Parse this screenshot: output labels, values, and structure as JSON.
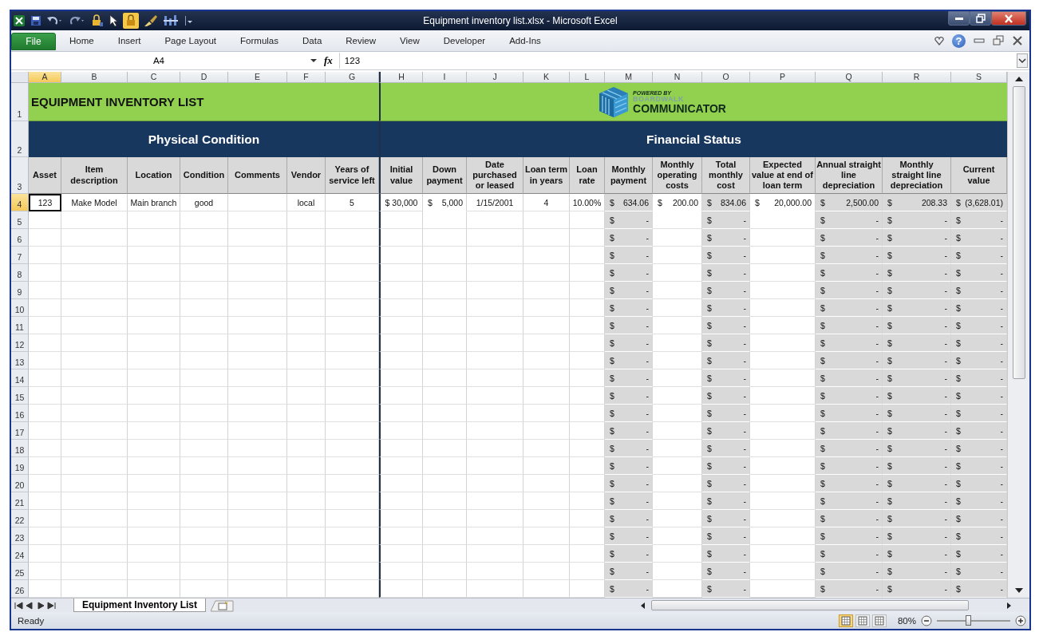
{
  "window": {
    "title": "Equipment inventory list.xlsx  -  Microsoft Excel"
  },
  "ribbon_tabs": [
    {
      "label": "File",
      "kind": "file"
    },
    {
      "label": "Home",
      "kind": "tab"
    },
    {
      "label": "Insert",
      "kind": "tab"
    },
    {
      "label": "Page Layout",
      "kind": "tab"
    },
    {
      "label": "Formulas",
      "kind": "tab"
    },
    {
      "label": "Data",
      "kind": "tab"
    },
    {
      "label": "Review",
      "kind": "tab"
    },
    {
      "label": "View",
      "kind": "tab"
    },
    {
      "label": "Developer",
      "kind": "tab"
    },
    {
      "label": "Add-Ins",
      "kind": "tab"
    }
  ],
  "help_label": "?",
  "formula_bar": {
    "name_box": "A4",
    "fx": "fx",
    "value": "123"
  },
  "columns": [
    {
      "letter": "A",
      "selected": true
    },
    {
      "letter": "B",
      "selected": false
    },
    {
      "letter": "C",
      "selected": false
    },
    {
      "letter": "D",
      "selected": false
    },
    {
      "letter": "E",
      "selected": false
    },
    {
      "letter": "F",
      "selected": false
    },
    {
      "letter": "G",
      "selected": false
    },
    {
      "letter": "H",
      "selected": false
    },
    {
      "letter": "I",
      "selected": false
    },
    {
      "letter": "J",
      "selected": false
    },
    {
      "letter": "K",
      "selected": false
    },
    {
      "letter": "L",
      "selected": false
    },
    {
      "letter": "M",
      "selected": false
    },
    {
      "letter": "N",
      "selected": false
    },
    {
      "letter": "O",
      "selected": false
    },
    {
      "letter": "P",
      "selected": false
    },
    {
      "letter": "Q",
      "selected": false
    },
    {
      "letter": "R",
      "selected": false
    },
    {
      "letter": "S",
      "selected": false
    }
  ],
  "row_headers": [
    {
      "label": "1",
      "selected": false
    },
    {
      "label": "2",
      "selected": false
    },
    {
      "label": "3",
      "selected": false
    },
    {
      "label": "4",
      "selected": true
    },
    {
      "label": "5",
      "selected": false
    },
    {
      "label": "6",
      "selected": false
    },
    {
      "label": "7",
      "selected": false
    },
    {
      "label": "8",
      "selected": false
    },
    {
      "label": "9",
      "selected": false
    },
    {
      "label": "10",
      "selected": false
    },
    {
      "label": "11",
      "selected": false
    },
    {
      "label": "12",
      "selected": false
    },
    {
      "label": "13",
      "selected": false
    },
    {
      "label": "14",
      "selected": false
    },
    {
      "label": "15",
      "selected": false
    },
    {
      "label": "16",
      "selected": false
    },
    {
      "label": "17",
      "selected": false
    },
    {
      "label": "18",
      "selected": false
    },
    {
      "label": "19",
      "selected": false
    },
    {
      "label": "20",
      "selected": false
    },
    {
      "label": "21",
      "selected": false
    },
    {
      "label": "22",
      "selected": false
    },
    {
      "label": "23",
      "selected": false
    },
    {
      "label": "24",
      "selected": false
    },
    {
      "label": "25",
      "selected": false
    },
    {
      "label": "26",
      "selected": false
    }
  ],
  "sheet": {
    "title": "EQUIPMENT INVENTORY LIST",
    "logo": {
      "tagline": "POWERED BY",
      "brand": "BOARDWALK",
      "product": "COMMUNICATOR"
    },
    "sections": [
      {
        "label": "Physical Condition"
      },
      {
        "label": "Financial Status"
      }
    ],
    "headings": [
      "Asset",
      "Item description",
      "Location",
      "Condition",
      "Comments",
      "Vendor",
      "Years of service left",
      "Initial value",
      "Down payment",
      "Date purchased or leased",
      "Loan term in years",
      "Loan rate",
      "Monthly payment",
      "Monthly operating costs",
      "Total monthly cost",
      "Expected value at end of loan term",
      "Annual straight line depreciation",
      "Monthly straight line depreciation",
      "Current value"
    ],
    "rows": [
      {
        "cells": [
          {
            "kind": "text",
            "text": "123",
            "selected": true
          },
          {
            "kind": "text",
            "text": "Make Model",
            "selected": false
          },
          {
            "kind": "text",
            "text": "Main branch",
            "selected": false
          },
          {
            "kind": "text",
            "text": "good",
            "selected": false
          },
          {
            "kind": "empty"
          },
          {
            "kind": "text",
            "text": "local",
            "selected": false
          },
          {
            "kind": "text",
            "text": "5",
            "selected": false
          },
          {
            "kind": "text",
            "text": "$ 30,000",
            "selected": false
          },
          {
            "kind": "money",
            "symbol": "$",
            "amount": "5,000",
            "shaded": false
          },
          {
            "kind": "text",
            "text": "1/15/2001",
            "selected": false
          },
          {
            "kind": "text",
            "text": "4",
            "selected": false
          },
          {
            "kind": "text",
            "text": "10.00%",
            "selected": false
          },
          {
            "kind": "money",
            "symbol": "$",
            "amount": "634.06",
            "shaded": true
          },
          {
            "kind": "money",
            "symbol": "$",
            "amount": "200.00",
            "shaded": false
          },
          {
            "kind": "money",
            "symbol": "$",
            "amount": "834.06",
            "shaded": true
          },
          {
            "kind": "money",
            "symbol": "$",
            "amount": "20,000.00",
            "shaded": false
          },
          {
            "kind": "money",
            "symbol": "$",
            "amount": "2,500.00",
            "shaded": true
          },
          {
            "kind": "money",
            "symbol": "$",
            "amount": "208.33",
            "shaded": true
          },
          {
            "kind": "money",
            "symbol": "$",
            "amount": "(3,628.01)",
            "shaded": true
          }
        ]
      },
      {
        "cells": [
          {
            "kind": "empty"
          },
          {
            "kind": "empty"
          },
          {
            "kind": "empty"
          },
          {
            "kind": "empty"
          },
          {
            "kind": "empty"
          },
          {
            "kind": "empty"
          },
          {
            "kind": "empty"
          },
          {
            "kind": "empty"
          },
          {
            "kind": "empty"
          },
          {
            "kind": "empty"
          },
          {
            "kind": "empty"
          },
          {
            "kind": "empty"
          },
          {
            "kind": "money",
            "symbol": "$",
            "amount": "-",
            "shaded": true
          },
          {
            "kind": "empty"
          },
          {
            "kind": "money",
            "symbol": "$",
            "amount": "-",
            "shaded": true
          },
          {
            "kind": "empty"
          },
          {
            "kind": "money",
            "symbol": "$",
            "amount": "-",
            "shaded": true
          },
          {
            "kind": "money",
            "symbol": "$",
            "amount": "-",
            "shaded": true
          },
          {
            "kind": "money",
            "symbol": "$",
            "amount": "-",
            "shaded": true
          }
        ]
      },
      {
        "cells": [
          {
            "kind": "empty"
          },
          {
            "kind": "empty"
          },
          {
            "kind": "empty"
          },
          {
            "kind": "empty"
          },
          {
            "kind": "empty"
          },
          {
            "kind": "empty"
          },
          {
            "kind": "empty"
          },
          {
            "kind": "empty"
          },
          {
            "kind": "empty"
          },
          {
            "kind": "empty"
          },
          {
            "kind": "empty"
          },
          {
            "kind": "empty"
          },
          {
            "kind": "money",
            "symbol": "$",
            "amount": "-",
            "shaded": true
          },
          {
            "kind": "empty"
          },
          {
            "kind": "money",
            "symbol": "$",
            "amount": "-",
            "shaded": true
          },
          {
            "kind": "empty"
          },
          {
            "kind": "money",
            "symbol": "$",
            "amount": "-",
            "shaded": true
          },
          {
            "kind": "money",
            "symbol": "$",
            "amount": "-",
            "shaded": true
          },
          {
            "kind": "money",
            "symbol": "$",
            "amount": "-",
            "shaded": true
          }
        ]
      },
      {
        "cells": [
          {
            "kind": "empty"
          },
          {
            "kind": "empty"
          },
          {
            "kind": "empty"
          },
          {
            "kind": "empty"
          },
          {
            "kind": "empty"
          },
          {
            "kind": "empty"
          },
          {
            "kind": "empty"
          },
          {
            "kind": "empty"
          },
          {
            "kind": "empty"
          },
          {
            "kind": "empty"
          },
          {
            "kind": "empty"
          },
          {
            "kind": "empty"
          },
          {
            "kind": "money",
            "symbol": "$",
            "amount": "-",
            "shaded": true
          },
          {
            "kind": "empty"
          },
          {
            "kind": "money",
            "symbol": "$",
            "amount": "-",
            "shaded": true
          },
          {
            "kind": "empty"
          },
          {
            "kind": "money",
            "symbol": "$",
            "amount": "-",
            "shaded": true
          },
          {
            "kind": "money",
            "symbol": "$",
            "amount": "-",
            "shaded": true
          },
          {
            "kind": "money",
            "symbol": "$",
            "amount": "-",
            "shaded": true
          }
        ]
      },
      {
        "cells": [
          {
            "kind": "empty"
          },
          {
            "kind": "empty"
          },
          {
            "kind": "empty"
          },
          {
            "kind": "empty"
          },
          {
            "kind": "empty"
          },
          {
            "kind": "empty"
          },
          {
            "kind": "empty"
          },
          {
            "kind": "empty"
          },
          {
            "kind": "empty"
          },
          {
            "kind": "empty"
          },
          {
            "kind": "empty"
          },
          {
            "kind": "empty"
          },
          {
            "kind": "money",
            "symbol": "$",
            "amount": "-",
            "shaded": true
          },
          {
            "kind": "empty"
          },
          {
            "kind": "money",
            "symbol": "$",
            "amount": "-",
            "shaded": true
          },
          {
            "kind": "empty"
          },
          {
            "kind": "money",
            "symbol": "$",
            "amount": "-",
            "shaded": true
          },
          {
            "kind": "money",
            "symbol": "$",
            "amount": "-",
            "shaded": true
          },
          {
            "kind": "money",
            "symbol": "$",
            "amount": "-",
            "shaded": true
          }
        ]
      },
      {
        "cells": [
          {
            "kind": "empty"
          },
          {
            "kind": "empty"
          },
          {
            "kind": "empty"
          },
          {
            "kind": "empty"
          },
          {
            "kind": "empty"
          },
          {
            "kind": "empty"
          },
          {
            "kind": "empty"
          },
          {
            "kind": "empty"
          },
          {
            "kind": "empty"
          },
          {
            "kind": "empty"
          },
          {
            "kind": "empty"
          },
          {
            "kind": "empty"
          },
          {
            "kind": "money",
            "symbol": "$",
            "amount": "-",
            "shaded": true
          },
          {
            "kind": "empty"
          },
          {
            "kind": "money",
            "symbol": "$",
            "amount": "-",
            "shaded": true
          },
          {
            "kind": "empty"
          },
          {
            "kind": "money",
            "symbol": "$",
            "amount": "-",
            "shaded": true
          },
          {
            "kind": "money",
            "symbol": "$",
            "amount": "-",
            "shaded": true
          },
          {
            "kind": "money",
            "symbol": "$",
            "amount": "-",
            "shaded": true
          }
        ]
      },
      {
        "cells": [
          {
            "kind": "empty"
          },
          {
            "kind": "empty"
          },
          {
            "kind": "empty"
          },
          {
            "kind": "empty"
          },
          {
            "kind": "empty"
          },
          {
            "kind": "empty"
          },
          {
            "kind": "empty"
          },
          {
            "kind": "empty"
          },
          {
            "kind": "empty"
          },
          {
            "kind": "empty"
          },
          {
            "kind": "empty"
          },
          {
            "kind": "empty"
          },
          {
            "kind": "money",
            "symbol": "$",
            "amount": "-",
            "shaded": true
          },
          {
            "kind": "empty"
          },
          {
            "kind": "money",
            "symbol": "$",
            "amount": "-",
            "shaded": true
          },
          {
            "kind": "empty"
          },
          {
            "kind": "money",
            "symbol": "$",
            "amount": "-",
            "shaded": true
          },
          {
            "kind": "money",
            "symbol": "$",
            "amount": "-",
            "shaded": true
          },
          {
            "kind": "money",
            "symbol": "$",
            "amount": "-",
            "shaded": true
          }
        ]
      },
      {
        "cells": [
          {
            "kind": "empty"
          },
          {
            "kind": "empty"
          },
          {
            "kind": "empty"
          },
          {
            "kind": "empty"
          },
          {
            "kind": "empty"
          },
          {
            "kind": "empty"
          },
          {
            "kind": "empty"
          },
          {
            "kind": "empty"
          },
          {
            "kind": "empty"
          },
          {
            "kind": "empty"
          },
          {
            "kind": "empty"
          },
          {
            "kind": "empty"
          },
          {
            "kind": "money",
            "symbol": "$",
            "amount": "-",
            "shaded": true
          },
          {
            "kind": "empty"
          },
          {
            "kind": "money",
            "symbol": "$",
            "amount": "-",
            "shaded": true
          },
          {
            "kind": "empty"
          },
          {
            "kind": "money",
            "symbol": "$",
            "amount": "-",
            "shaded": true
          },
          {
            "kind": "money",
            "symbol": "$",
            "amount": "-",
            "shaded": true
          },
          {
            "kind": "money",
            "symbol": "$",
            "amount": "-",
            "shaded": true
          }
        ]
      },
      {
        "cells": [
          {
            "kind": "empty"
          },
          {
            "kind": "empty"
          },
          {
            "kind": "empty"
          },
          {
            "kind": "empty"
          },
          {
            "kind": "empty"
          },
          {
            "kind": "empty"
          },
          {
            "kind": "empty"
          },
          {
            "kind": "empty"
          },
          {
            "kind": "empty"
          },
          {
            "kind": "empty"
          },
          {
            "kind": "empty"
          },
          {
            "kind": "empty"
          },
          {
            "kind": "money",
            "symbol": "$",
            "amount": "-",
            "shaded": true
          },
          {
            "kind": "empty"
          },
          {
            "kind": "money",
            "symbol": "$",
            "amount": "-",
            "shaded": true
          },
          {
            "kind": "empty"
          },
          {
            "kind": "money",
            "symbol": "$",
            "amount": "-",
            "shaded": true
          },
          {
            "kind": "money",
            "symbol": "$",
            "amount": "-",
            "shaded": true
          },
          {
            "kind": "money",
            "symbol": "$",
            "amount": "-",
            "shaded": true
          }
        ]
      },
      {
        "cells": [
          {
            "kind": "empty"
          },
          {
            "kind": "empty"
          },
          {
            "kind": "empty"
          },
          {
            "kind": "empty"
          },
          {
            "kind": "empty"
          },
          {
            "kind": "empty"
          },
          {
            "kind": "empty"
          },
          {
            "kind": "empty"
          },
          {
            "kind": "empty"
          },
          {
            "kind": "empty"
          },
          {
            "kind": "empty"
          },
          {
            "kind": "empty"
          },
          {
            "kind": "money",
            "symbol": "$",
            "amount": "-",
            "shaded": true
          },
          {
            "kind": "empty"
          },
          {
            "kind": "money",
            "symbol": "$",
            "amount": "-",
            "shaded": true
          },
          {
            "kind": "empty"
          },
          {
            "kind": "money",
            "symbol": "$",
            "amount": "-",
            "shaded": true
          },
          {
            "kind": "money",
            "symbol": "$",
            "amount": "-",
            "shaded": true
          },
          {
            "kind": "money",
            "symbol": "$",
            "amount": "-",
            "shaded": true
          }
        ]
      },
      {
        "cells": [
          {
            "kind": "empty"
          },
          {
            "kind": "empty"
          },
          {
            "kind": "empty"
          },
          {
            "kind": "empty"
          },
          {
            "kind": "empty"
          },
          {
            "kind": "empty"
          },
          {
            "kind": "empty"
          },
          {
            "kind": "empty"
          },
          {
            "kind": "empty"
          },
          {
            "kind": "empty"
          },
          {
            "kind": "empty"
          },
          {
            "kind": "empty"
          },
          {
            "kind": "money",
            "symbol": "$",
            "amount": "-",
            "shaded": true
          },
          {
            "kind": "empty"
          },
          {
            "kind": "money",
            "symbol": "$",
            "amount": "-",
            "shaded": true
          },
          {
            "kind": "empty"
          },
          {
            "kind": "money",
            "symbol": "$",
            "amount": "-",
            "shaded": true
          },
          {
            "kind": "money",
            "symbol": "$",
            "amount": "-",
            "shaded": true
          },
          {
            "kind": "money",
            "symbol": "$",
            "amount": "-",
            "shaded": true
          }
        ]
      },
      {
        "cells": [
          {
            "kind": "empty"
          },
          {
            "kind": "empty"
          },
          {
            "kind": "empty"
          },
          {
            "kind": "empty"
          },
          {
            "kind": "empty"
          },
          {
            "kind": "empty"
          },
          {
            "kind": "empty"
          },
          {
            "kind": "empty"
          },
          {
            "kind": "empty"
          },
          {
            "kind": "empty"
          },
          {
            "kind": "empty"
          },
          {
            "kind": "empty"
          },
          {
            "kind": "money",
            "symbol": "$",
            "amount": "-",
            "shaded": true
          },
          {
            "kind": "empty"
          },
          {
            "kind": "money",
            "symbol": "$",
            "amount": "-",
            "shaded": true
          },
          {
            "kind": "empty"
          },
          {
            "kind": "money",
            "symbol": "$",
            "amount": "-",
            "shaded": true
          },
          {
            "kind": "money",
            "symbol": "$",
            "amount": "-",
            "shaded": true
          },
          {
            "kind": "money",
            "symbol": "$",
            "amount": "-",
            "shaded": true
          }
        ]
      },
      {
        "cells": [
          {
            "kind": "empty"
          },
          {
            "kind": "empty"
          },
          {
            "kind": "empty"
          },
          {
            "kind": "empty"
          },
          {
            "kind": "empty"
          },
          {
            "kind": "empty"
          },
          {
            "kind": "empty"
          },
          {
            "kind": "empty"
          },
          {
            "kind": "empty"
          },
          {
            "kind": "empty"
          },
          {
            "kind": "empty"
          },
          {
            "kind": "empty"
          },
          {
            "kind": "money",
            "symbol": "$",
            "amount": "-",
            "shaded": true
          },
          {
            "kind": "empty"
          },
          {
            "kind": "money",
            "symbol": "$",
            "amount": "-",
            "shaded": true
          },
          {
            "kind": "empty"
          },
          {
            "kind": "money",
            "symbol": "$",
            "amount": "-",
            "shaded": true
          },
          {
            "kind": "money",
            "symbol": "$",
            "amount": "-",
            "shaded": true
          },
          {
            "kind": "money",
            "symbol": "$",
            "amount": "-",
            "shaded": true
          }
        ]
      },
      {
        "cells": [
          {
            "kind": "empty"
          },
          {
            "kind": "empty"
          },
          {
            "kind": "empty"
          },
          {
            "kind": "empty"
          },
          {
            "kind": "empty"
          },
          {
            "kind": "empty"
          },
          {
            "kind": "empty"
          },
          {
            "kind": "empty"
          },
          {
            "kind": "empty"
          },
          {
            "kind": "empty"
          },
          {
            "kind": "empty"
          },
          {
            "kind": "empty"
          },
          {
            "kind": "money",
            "symbol": "$",
            "amount": "-",
            "shaded": true
          },
          {
            "kind": "empty"
          },
          {
            "kind": "money",
            "symbol": "$",
            "amount": "-",
            "shaded": true
          },
          {
            "kind": "empty"
          },
          {
            "kind": "money",
            "symbol": "$",
            "amount": "-",
            "shaded": true
          },
          {
            "kind": "money",
            "symbol": "$",
            "amount": "-",
            "shaded": true
          },
          {
            "kind": "money",
            "symbol": "$",
            "amount": "-",
            "shaded": true
          }
        ]
      },
      {
        "cells": [
          {
            "kind": "empty"
          },
          {
            "kind": "empty"
          },
          {
            "kind": "empty"
          },
          {
            "kind": "empty"
          },
          {
            "kind": "empty"
          },
          {
            "kind": "empty"
          },
          {
            "kind": "empty"
          },
          {
            "kind": "empty"
          },
          {
            "kind": "empty"
          },
          {
            "kind": "empty"
          },
          {
            "kind": "empty"
          },
          {
            "kind": "empty"
          },
          {
            "kind": "money",
            "symbol": "$",
            "amount": "-",
            "shaded": true
          },
          {
            "kind": "empty"
          },
          {
            "kind": "money",
            "symbol": "$",
            "amount": "-",
            "shaded": true
          },
          {
            "kind": "empty"
          },
          {
            "kind": "money",
            "symbol": "$",
            "amount": "-",
            "shaded": true
          },
          {
            "kind": "money",
            "symbol": "$",
            "amount": "-",
            "shaded": true
          },
          {
            "kind": "money",
            "symbol": "$",
            "amount": "-",
            "shaded": true
          }
        ]
      },
      {
        "cells": [
          {
            "kind": "empty"
          },
          {
            "kind": "empty"
          },
          {
            "kind": "empty"
          },
          {
            "kind": "empty"
          },
          {
            "kind": "empty"
          },
          {
            "kind": "empty"
          },
          {
            "kind": "empty"
          },
          {
            "kind": "empty"
          },
          {
            "kind": "empty"
          },
          {
            "kind": "empty"
          },
          {
            "kind": "empty"
          },
          {
            "kind": "empty"
          },
          {
            "kind": "money",
            "symbol": "$",
            "amount": "-",
            "shaded": true
          },
          {
            "kind": "empty"
          },
          {
            "kind": "money",
            "symbol": "$",
            "amount": "-",
            "shaded": true
          },
          {
            "kind": "empty"
          },
          {
            "kind": "money",
            "symbol": "$",
            "amount": "-",
            "shaded": true
          },
          {
            "kind": "money",
            "symbol": "$",
            "amount": "-",
            "shaded": true
          },
          {
            "kind": "money",
            "symbol": "$",
            "amount": "-",
            "shaded": true
          }
        ]
      },
      {
        "cells": [
          {
            "kind": "empty"
          },
          {
            "kind": "empty"
          },
          {
            "kind": "empty"
          },
          {
            "kind": "empty"
          },
          {
            "kind": "empty"
          },
          {
            "kind": "empty"
          },
          {
            "kind": "empty"
          },
          {
            "kind": "empty"
          },
          {
            "kind": "empty"
          },
          {
            "kind": "empty"
          },
          {
            "kind": "empty"
          },
          {
            "kind": "empty"
          },
          {
            "kind": "money",
            "symbol": "$",
            "amount": "-",
            "shaded": true
          },
          {
            "kind": "empty"
          },
          {
            "kind": "money",
            "symbol": "$",
            "amount": "-",
            "shaded": true
          },
          {
            "kind": "empty"
          },
          {
            "kind": "money",
            "symbol": "$",
            "amount": "-",
            "shaded": true
          },
          {
            "kind": "money",
            "symbol": "$",
            "amount": "-",
            "shaded": true
          },
          {
            "kind": "money",
            "symbol": "$",
            "amount": "-",
            "shaded": true
          }
        ]
      },
      {
        "cells": [
          {
            "kind": "empty"
          },
          {
            "kind": "empty"
          },
          {
            "kind": "empty"
          },
          {
            "kind": "empty"
          },
          {
            "kind": "empty"
          },
          {
            "kind": "empty"
          },
          {
            "kind": "empty"
          },
          {
            "kind": "empty"
          },
          {
            "kind": "empty"
          },
          {
            "kind": "empty"
          },
          {
            "kind": "empty"
          },
          {
            "kind": "empty"
          },
          {
            "kind": "money",
            "symbol": "$",
            "amount": "-",
            "shaded": true
          },
          {
            "kind": "empty"
          },
          {
            "kind": "money",
            "symbol": "$",
            "amount": "-",
            "shaded": true
          },
          {
            "kind": "empty"
          },
          {
            "kind": "money",
            "symbol": "$",
            "amount": "-",
            "shaded": true
          },
          {
            "kind": "money",
            "symbol": "$",
            "amount": "-",
            "shaded": true
          },
          {
            "kind": "money",
            "symbol": "$",
            "amount": "-",
            "shaded": true
          }
        ]
      },
      {
        "cells": [
          {
            "kind": "empty"
          },
          {
            "kind": "empty"
          },
          {
            "kind": "empty"
          },
          {
            "kind": "empty"
          },
          {
            "kind": "empty"
          },
          {
            "kind": "empty"
          },
          {
            "kind": "empty"
          },
          {
            "kind": "empty"
          },
          {
            "kind": "empty"
          },
          {
            "kind": "empty"
          },
          {
            "kind": "empty"
          },
          {
            "kind": "empty"
          },
          {
            "kind": "money",
            "symbol": "$",
            "amount": "-",
            "shaded": true
          },
          {
            "kind": "empty"
          },
          {
            "kind": "money",
            "symbol": "$",
            "amount": "-",
            "shaded": true
          },
          {
            "kind": "empty"
          },
          {
            "kind": "money",
            "symbol": "$",
            "amount": "-",
            "shaded": true
          },
          {
            "kind": "money",
            "symbol": "$",
            "amount": "-",
            "shaded": true
          },
          {
            "kind": "money",
            "symbol": "$",
            "amount": "-",
            "shaded": true
          }
        ]
      },
      {
        "cells": [
          {
            "kind": "empty"
          },
          {
            "kind": "empty"
          },
          {
            "kind": "empty"
          },
          {
            "kind": "empty"
          },
          {
            "kind": "empty"
          },
          {
            "kind": "empty"
          },
          {
            "kind": "empty"
          },
          {
            "kind": "empty"
          },
          {
            "kind": "empty"
          },
          {
            "kind": "empty"
          },
          {
            "kind": "empty"
          },
          {
            "kind": "empty"
          },
          {
            "kind": "money",
            "symbol": "$",
            "amount": "-",
            "shaded": true
          },
          {
            "kind": "empty"
          },
          {
            "kind": "money",
            "symbol": "$",
            "amount": "-",
            "shaded": true
          },
          {
            "kind": "empty"
          },
          {
            "kind": "money",
            "symbol": "$",
            "amount": "-",
            "shaded": true
          },
          {
            "kind": "money",
            "symbol": "$",
            "amount": "-",
            "shaded": true
          },
          {
            "kind": "money",
            "symbol": "$",
            "amount": "-",
            "shaded": true
          }
        ]
      },
      {
        "cells": [
          {
            "kind": "empty"
          },
          {
            "kind": "empty"
          },
          {
            "kind": "empty"
          },
          {
            "kind": "empty"
          },
          {
            "kind": "empty"
          },
          {
            "kind": "empty"
          },
          {
            "kind": "empty"
          },
          {
            "kind": "empty"
          },
          {
            "kind": "empty"
          },
          {
            "kind": "empty"
          },
          {
            "kind": "empty"
          },
          {
            "kind": "empty"
          },
          {
            "kind": "money",
            "symbol": "$",
            "amount": "-",
            "shaded": true
          },
          {
            "kind": "empty"
          },
          {
            "kind": "money",
            "symbol": "$",
            "amount": "-",
            "shaded": true
          },
          {
            "kind": "empty"
          },
          {
            "kind": "money",
            "symbol": "$",
            "amount": "-",
            "shaded": true
          },
          {
            "kind": "money",
            "symbol": "$",
            "amount": "-",
            "shaded": true
          },
          {
            "kind": "money",
            "symbol": "$",
            "amount": "-",
            "shaded": true
          }
        ]
      },
      {
        "cells": [
          {
            "kind": "empty"
          },
          {
            "kind": "empty"
          },
          {
            "kind": "empty"
          },
          {
            "kind": "empty"
          },
          {
            "kind": "empty"
          },
          {
            "kind": "empty"
          },
          {
            "kind": "empty"
          },
          {
            "kind": "empty"
          },
          {
            "kind": "empty"
          },
          {
            "kind": "empty"
          },
          {
            "kind": "empty"
          },
          {
            "kind": "empty"
          },
          {
            "kind": "money",
            "symbol": "$",
            "amount": "-",
            "shaded": true
          },
          {
            "kind": "empty"
          },
          {
            "kind": "money",
            "symbol": "$",
            "amount": "-",
            "shaded": true
          },
          {
            "kind": "empty"
          },
          {
            "kind": "money",
            "symbol": "$",
            "amount": "-",
            "shaded": true
          },
          {
            "kind": "money",
            "symbol": "$",
            "amount": "-",
            "shaded": true
          },
          {
            "kind": "money",
            "symbol": "$",
            "amount": "-",
            "shaded": true
          }
        ]
      },
      {
        "cells": [
          {
            "kind": "empty"
          },
          {
            "kind": "empty"
          },
          {
            "kind": "empty"
          },
          {
            "kind": "empty"
          },
          {
            "kind": "empty"
          },
          {
            "kind": "empty"
          },
          {
            "kind": "empty"
          },
          {
            "kind": "empty"
          },
          {
            "kind": "empty"
          },
          {
            "kind": "empty"
          },
          {
            "kind": "empty"
          },
          {
            "kind": "empty"
          },
          {
            "kind": "money",
            "symbol": "$",
            "amount": "-",
            "shaded": true
          },
          {
            "kind": "empty"
          },
          {
            "kind": "money",
            "symbol": "$",
            "amount": "-",
            "shaded": true
          },
          {
            "kind": "empty"
          },
          {
            "kind": "money",
            "symbol": "$",
            "amount": "-",
            "shaded": true
          },
          {
            "kind": "money",
            "symbol": "$",
            "amount": "-",
            "shaded": true
          },
          {
            "kind": "money",
            "symbol": "$",
            "amount": "-",
            "shaded": true
          }
        ]
      }
    ]
  },
  "sheet_tabs": [
    {
      "label": "Equipment Inventory List",
      "selected": true
    }
  ],
  "status_bar": {
    "text": "Ready",
    "view_buttons": [
      {
        "selected": true
      },
      {
        "selected": false
      },
      {
        "selected": false
      }
    ],
    "zoom": "80%",
    "zoom_slider": {
      "level": 0.42
    }
  }
}
